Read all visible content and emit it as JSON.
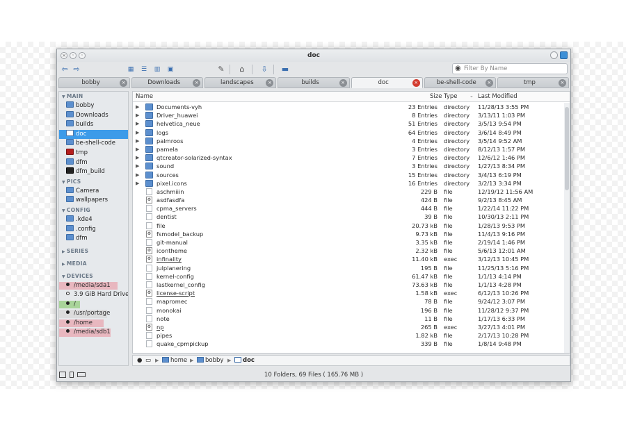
{
  "window": {
    "title": "doc"
  },
  "toolbar": {
    "filter_placeholder": "Filter By Name",
    "icons": [
      "back-icon",
      "forward-icon",
      "icon-view-icon",
      "details-view-icon",
      "columns-view-icon",
      "preview-icon",
      "settings-icon",
      "home-icon",
      "bookmark-icon",
      "folder-icon"
    ]
  },
  "tabs": [
    {
      "label": "bobby"
    },
    {
      "label": "Downloads"
    },
    {
      "label": "landscapes"
    },
    {
      "label": "builds"
    },
    {
      "label": "doc",
      "active": true
    },
    {
      "label": "be-shell-code"
    },
    {
      "label": "tmp"
    }
  ],
  "sidebar": {
    "main_title": "MAIN",
    "main": [
      "bobby",
      "Downloads",
      "builds",
      "doc",
      "be-shell-code",
      "tmp",
      "dfm",
      "dfm_build"
    ],
    "pics_title": "PICS",
    "pics": [
      "Camera",
      "wallpapers"
    ],
    "config_title": "CONFIG",
    "config": [
      ".kde4",
      ".config",
      "dfm"
    ],
    "series_title": "SERIES",
    "media_title": "MEDIA",
    "devices_title": "DEVICES",
    "devices": [
      {
        "label": "/media/sda1",
        "color": "#e8b7bf",
        "usage": 0.85
      },
      {
        "label": "3.9 GiB Hard Drive",
        "color": "#ffffff",
        "usage": 0
      },
      {
        "label": "/",
        "color": "#a9d49a",
        "usage": 0.3
      },
      {
        "label": "/usr/portage",
        "color": "#dcdcdc",
        "usage": 0.7
      },
      {
        "label": "/home",
        "color": "#e8b7bf",
        "usage": 0.65
      },
      {
        "label": "/media/sdb1",
        "color": "#e8b7bf",
        "usage": 0.75
      }
    ]
  },
  "columns": {
    "name": "Name",
    "size": "Size",
    "type": "Type",
    "modified": "Last Modified"
  },
  "files": [
    {
      "name": "Documents-vyh",
      "size": "23 Entries",
      "type": "directory",
      "modified": "11/28/13 3:55 PM",
      "kind": "folder"
    },
    {
      "name": "Driver_huawei",
      "size": "8 Entries",
      "type": "directory",
      "modified": "3/13/11 1:03 PM",
      "kind": "folder"
    },
    {
      "name": "helvetica_neue",
      "size": "51 Entries",
      "type": "directory",
      "modified": "3/5/13 9:54 PM",
      "kind": "folder"
    },
    {
      "name": "logs",
      "size": "64 Entries",
      "type": "directory",
      "modified": "3/6/14 8:49 PM",
      "kind": "folder"
    },
    {
      "name": "palmroos",
      "size": "4 Entries",
      "type": "directory",
      "modified": "3/5/14 9:52 AM",
      "kind": "folder"
    },
    {
      "name": "pamela",
      "size": "3 Entries",
      "type": "directory",
      "modified": "8/12/13 1:57 PM",
      "kind": "folder"
    },
    {
      "name": "qtcreator-solarized-syntax",
      "size": "7 Entries",
      "type": "directory",
      "modified": "12/6/12 1:46 PM",
      "kind": "folder"
    },
    {
      "name": "sound",
      "size": "3 Entries",
      "type": "directory",
      "modified": "1/27/13 8:34 PM",
      "kind": "folder"
    },
    {
      "name": "sources",
      "size": "15 Entries",
      "type": "directory",
      "modified": "3/4/13 6:19 PM",
      "kind": "folder"
    },
    {
      "name": "pixel.icons",
      "size": "16 Entries",
      "type": "directory",
      "modified": "3/2/13 3:34 PM",
      "kind": "folder"
    },
    {
      "name": "aschmiiin",
      "size": "229 B",
      "type": "file",
      "modified": "12/19/12 11:56 AM",
      "kind": "file"
    },
    {
      "name": "asdfasdfa",
      "size": "424 B",
      "type": "file",
      "modified": "9/2/13 8:45 AM",
      "kind": "exec"
    },
    {
      "name": "cpma_servers",
      "size": "444 B",
      "type": "file",
      "modified": "1/22/14 11:22 PM",
      "kind": "file"
    },
    {
      "name": "dentist",
      "size": "39 B",
      "type": "file",
      "modified": "10/30/13 2:11 PM",
      "kind": "file"
    },
    {
      "name": "file",
      "size": "20.73 kB",
      "type": "file",
      "modified": "1/28/13 9:53 PM",
      "kind": "file"
    },
    {
      "name": "fsmodel_backup",
      "size": "9.73 kB",
      "type": "file",
      "modified": "11/4/13 9:16 PM",
      "kind": "exec"
    },
    {
      "name": "git-manual",
      "size": "3.35 kB",
      "type": "file",
      "modified": "2/19/14 1:46 PM",
      "kind": "file"
    },
    {
      "name": "icontheme",
      "size": "2.32 kB",
      "type": "file",
      "modified": "5/6/13 12:01 AM",
      "kind": "exec"
    },
    {
      "name": "infinality",
      "size": "11.40 kB",
      "type": "exec",
      "modified": "3/12/13 10:45 PM",
      "kind": "exec",
      "underline": true
    },
    {
      "name": "julplanering",
      "size": "195 B",
      "type": "file",
      "modified": "11/25/13 5:16 PM",
      "kind": "file"
    },
    {
      "name": "kernel-config",
      "size": "61.47 kB",
      "type": "file",
      "modified": "1/1/13 4:14 PM",
      "kind": "file"
    },
    {
      "name": "lastkernel_config",
      "size": "73.63 kB",
      "type": "file",
      "modified": "1/1/13 4:28 PM",
      "kind": "file"
    },
    {
      "name": "license-script",
      "size": "1.58 kB",
      "type": "exec",
      "modified": "6/12/13 10:26 PM",
      "kind": "exec",
      "underline": true
    },
    {
      "name": "mapromec",
      "size": "78 B",
      "type": "file",
      "modified": "9/24/12 3:07 PM",
      "kind": "file"
    },
    {
      "name": "monokai",
      "size": "196 B",
      "type": "file",
      "modified": "11/28/12 9:37 PM",
      "kind": "file"
    },
    {
      "name": "note",
      "size": "11 B",
      "type": "file",
      "modified": "1/17/13 6:33 PM",
      "kind": "file"
    },
    {
      "name": "np",
      "size": "265 B",
      "type": "exec",
      "modified": "3/27/13 4:01 PM",
      "kind": "exec",
      "underline": true
    },
    {
      "name": "pipes",
      "size": "1.82 kB",
      "type": "file",
      "modified": "2/17/13 10:28 PM",
      "kind": "file"
    },
    {
      "name": "quake_cpmpickup",
      "size": "339 B",
      "type": "file",
      "modified": "1/8/14 9:48 PM",
      "kind": "file"
    }
  ],
  "breadcrumb": [
    "home",
    "bobby",
    "doc"
  ],
  "status": {
    "text": "10 Folders, 69 Files ( 165.76 MB )"
  },
  "colors": {
    "accent": "#3d9be9",
    "folder": "#5c8fce",
    "close_active": "#d23b2f"
  }
}
